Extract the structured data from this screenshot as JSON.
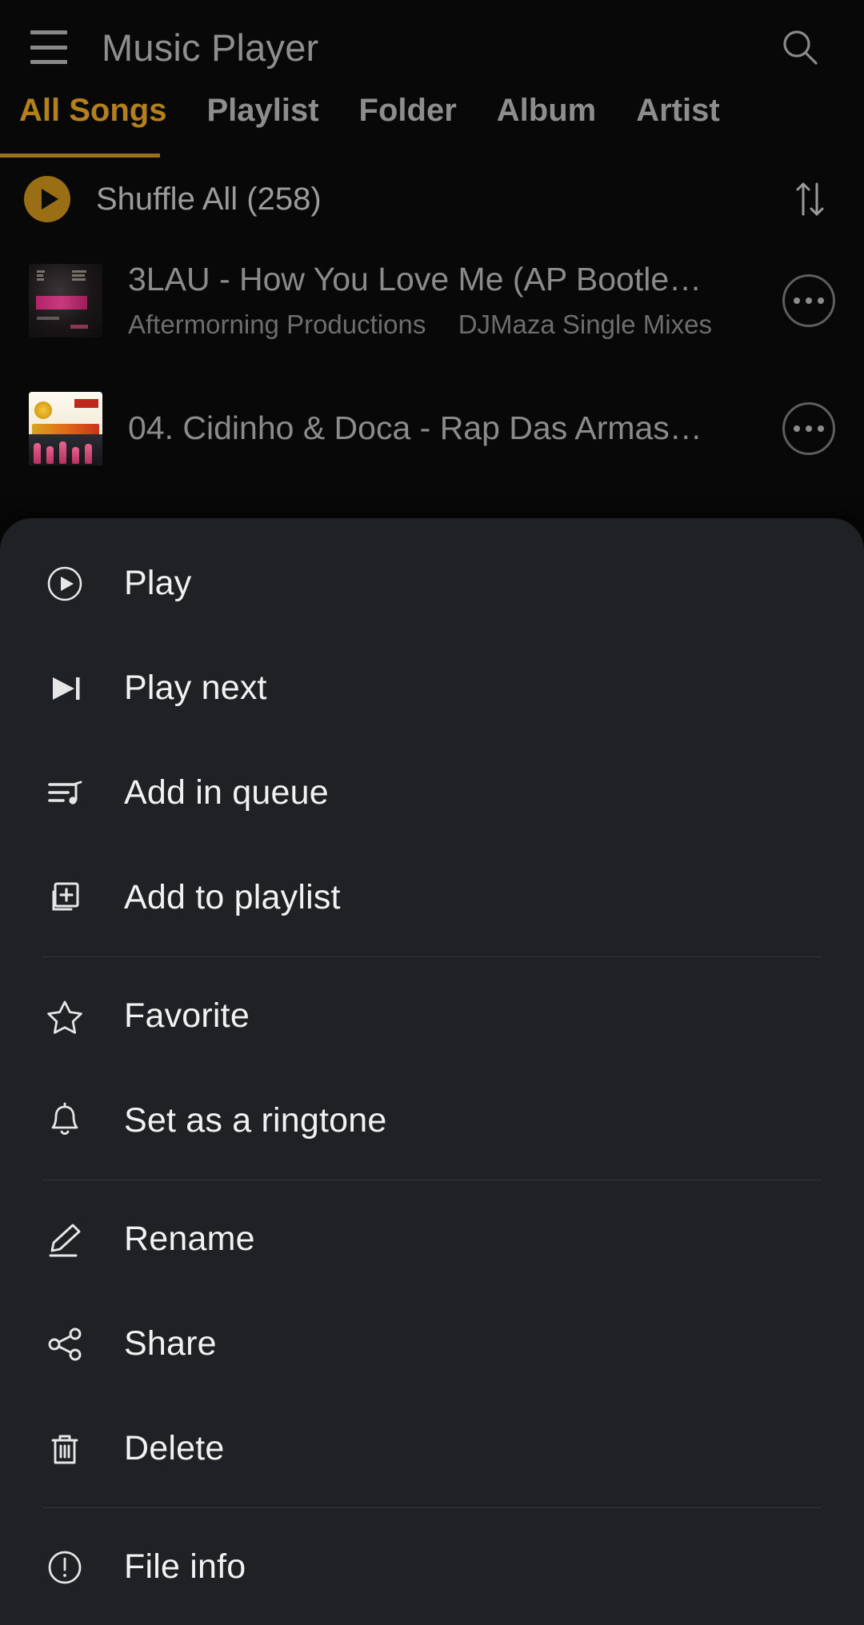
{
  "header": {
    "title": "Music Player",
    "menu_icon": "hamburger-icon",
    "search_icon": "search-icon"
  },
  "tabs": [
    {
      "label": "All Songs",
      "active": true
    },
    {
      "label": "Playlist",
      "active": false
    },
    {
      "label": "Folder",
      "active": false
    },
    {
      "label": "Album",
      "active": false
    },
    {
      "label": "Artist",
      "active": false
    }
  ],
  "shuffle": {
    "label": "Shuffle All (258)",
    "count": 258,
    "play_icon": "play-icon",
    "sort_icon": "sort-arrows-icon"
  },
  "songs": [
    {
      "title": "3LAU - How You Love Me (AP Bootle…",
      "artist": "Aftermorning Productions",
      "album": "DJMaza Single Mixes",
      "art": "3lau-album-art",
      "more_icon": "more-options-icon"
    },
    {
      "title": "04. Cidinho & Doca - Rap Das Armas…",
      "artist": "",
      "album": "",
      "art": "zumba-album-art",
      "more_icon": "more-options-icon"
    }
  ],
  "sheet": {
    "groups": [
      {
        "items": [
          {
            "label": "Play",
            "icon": "play-circle-icon"
          },
          {
            "label": "Play next",
            "icon": "play-next-icon"
          },
          {
            "label": "Add in queue",
            "icon": "queue-music-icon"
          },
          {
            "label": "Add to playlist",
            "icon": "add-to-playlist-icon"
          }
        ]
      },
      {
        "items": [
          {
            "label": "Favorite",
            "icon": "star-icon"
          },
          {
            "label": "Set as a ringtone",
            "icon": "bell-icon"
          }
        ]
      },
      {
        "items": [
          {
            "label": "Rename",
            "icon": "pencil-icon"
          },
          {
            "label": "Share",
            "icon": "share-icon"
          },
          {
            "label": "Delete",
            "icon": "trash-icon"
          }
        ]
      },
      {
        "items": [
          {
            "label": "File info",
            "icon": "info-icon"
          }
        ]
      }
    ]
  },
  "colors": {
    "background": "#080808",
    "accent": "#b4801c",
    "accent_underline": "#9a6e1a",
    "sheet_background": "#1f2124",
    "primary_text": "#f2f2f2",
    "secondary_text": "#8b8b8b"
  }
}
